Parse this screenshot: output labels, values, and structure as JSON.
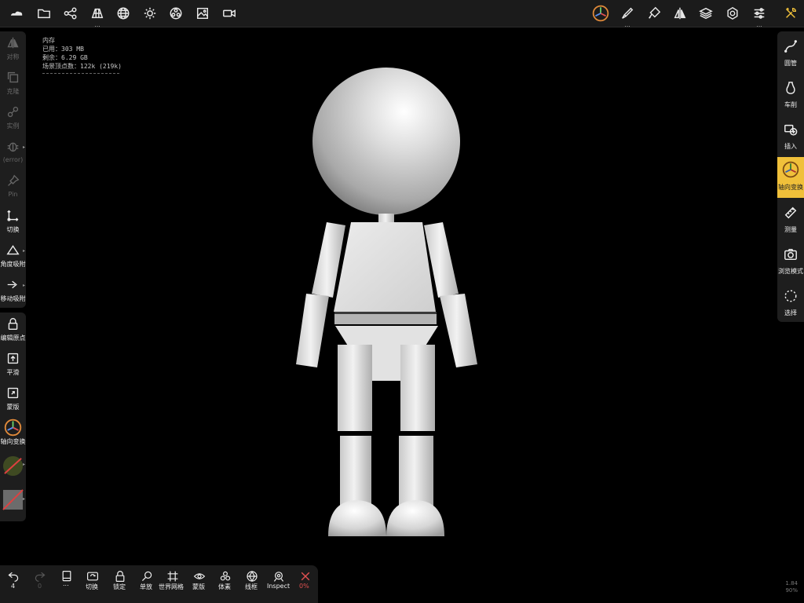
{
  "top_toolbar": {
    "left_icons": [
      "cloud-icon",
      "folder-icon",
      "scene-graph-icon",
      "scene-icon",
      "sphere-grid-icon",
      "sun-icon",
      "material-icon",
      "image-icon",
      "camera-icon"
    ],
    "right_icons": [
      "gizmo-icon",
      "brush-icon",
      "paint-icon",
      "symmetry-icon",
      "layers-icon",
      "settings-icon",
      "sliders-icon",
      "tools-icon"
    ],
    "more_indicator": "..."
  },
  "memory": {
    "title": "内存",
    "used": "已用：303 MB",
    "free": "剩余：6.29 GB",
    "vertices": "场景顶点数：122k (219k)"
  },
  "left_tools": [
    {
      "label": "对称",
      "icon": "symmetry-icon"
    },
    {
      "label": "克隆",
      "icon": "clone-icon"
    },
    {
      "label": "实例",
      "icon": "link-icon"
    },
    {
      "label": "(error)",
      "icon": "bug-icon"
    },
    {
      "label": "Pin",
      "icon": "pin-icon"
    },
    {
      "label": "切换",
      "icon": "transform-axes-icon"
    },
    {
      "label": "角度吸附",
      "icon": "angle-snap-icon"
    },
    {
      "label": "移动吸附",
      "icon": "move-snap-icon"
    },
    {
      "label": "编辑原点",
      "icon": "lock-icon"
    },
    {
      "label": "平滑",
      "icon": "smooth-icon"
    },
    {
      "label": "蒙版",
      "icon": "mask-icon"
    },
    {
      "label": "轴向变换",
      "icon": "gizmo-icon"
    }
  ],
  "right_tools": [
    {
      "label": "圆管",
      "icon": "tube-icon"
    },
    {
      "label": "车削",
      "icon": "lathe-icon"
    },
    {
      "label": "插入",
      "icon": "insert-icon"
    },
    {
      "label": "轴向变换",
      "icon": "gizmo-icon"
    },
    {
      "label": "测量",
      "icon": "ruler-icon"
    },
    {
      "label": "浏览模式",
      "icon": "camera-icon"
    },
    {
      "label": "选择",
      "icon": "selection-icon"
    }
  ],
  "bottom_tools": {
    "undo": {
      "count": "4"
    },
    "redo": {
      "count": "0"
    },
    "more": "...",
    "items": [
      "切换",
      "锁定",
      "单放",
      "世界网格",
      "蒙版",
      "体素",
      "线框",
      "Inspect"
    ],
    "close_percent": "0%"
  },
  "version": {
    "line1": "1.84",
    "line2": "90%"
  },
  "colors": {
    "accent": "#f0c03a",
    "close": "#e05050",
    "panel": "#1e1e1e"
  }
}
